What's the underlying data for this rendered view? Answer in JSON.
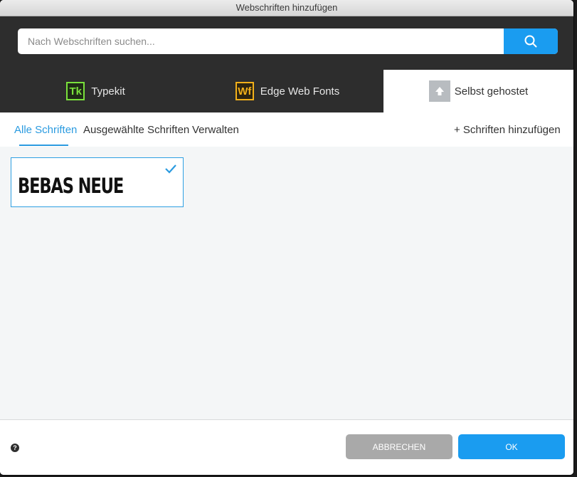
{
  "window": {
    "title": "Webschriften hinzufügen"
  },
  "search": {
    "placeholder": "Nach Webschriften suchen...",
    "value": "",
    "icon": "search-icon"
  },
  "providers": [
    {
      "badge": "Tk",
      "label": "Typekit",
      "color": "#7ae13c"
    },
    {
      "badge": "Wf",
      "label": "Edge Web Fonts",
      "color": "#f2b01a"
    },
    {
      "label": "Selbst gehostet",
      "icon": "upload-icon",
      "active": true
    }
  ],
  "subnav": {
    "items": [
      "Alle Schriften",
      "Ausgewählte Schriften",
      "Verwalten"
    ],
    "active_index": 0,
    "add_fonts": "+ Schriften hinzufügen"
  },
  "fonts": [
    {
      "name": "BEBAS NEUE",
      "selected": true
    }
  ],
  "footer": {
    "help_icon": "help-icon",
    "cancel": "ABBRECHEN",
    "ok": "OK"
  },
  "colors": {
    "accent": "#1a9cf0",
    "dark_bar": "#2d2d2d",
    "content_bg": "#f4f6f7",
    "cancel_bg": "#a9a9a9"
  }
}
